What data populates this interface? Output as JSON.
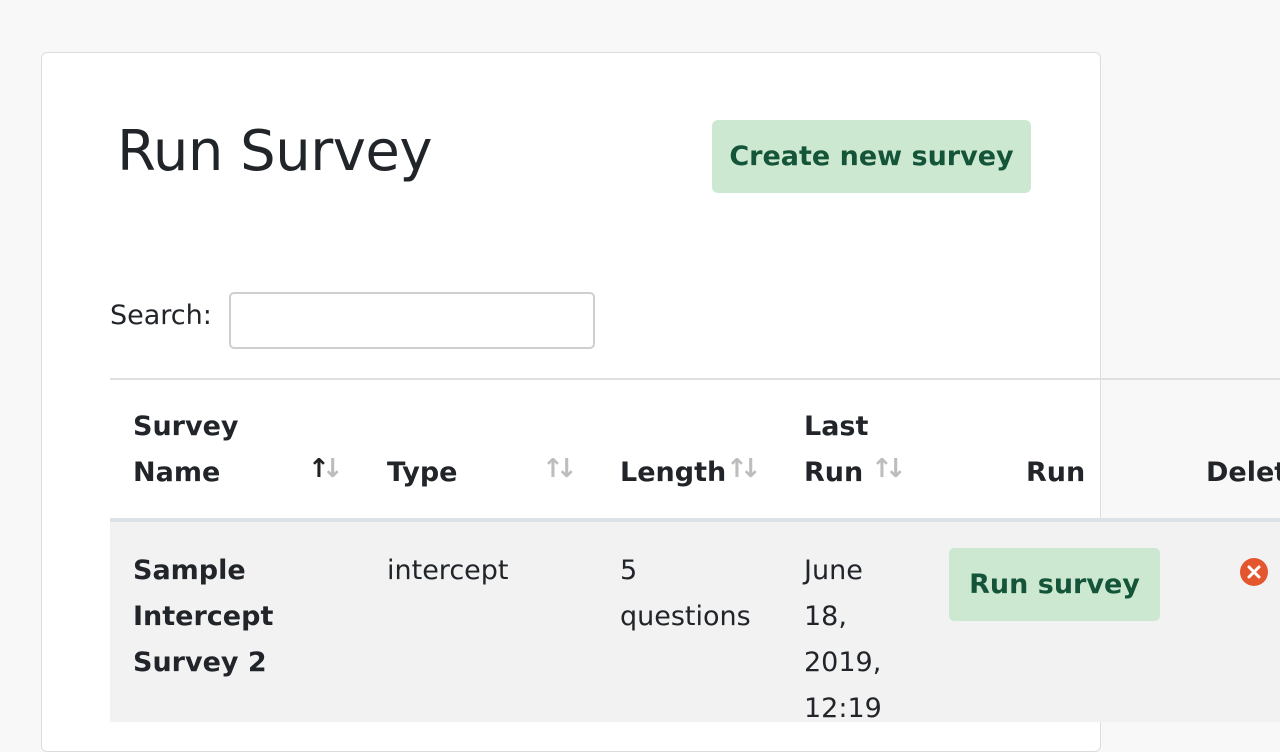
{
  "page": {
    "title": "Run Survey",
    "create_button_label": "Create new survey"
  },
  "search": {
    "label": "Search:",
    "value": "",
    "placeholder": ""
  },
  "table": {
    "headers": {
      "survey_name_1": "Survey",
      "survey_name_2": "Name",
      "type": "Type",
      "length": "Length",
      "last_run_1": "Last",
      "last_run_2": "Run",
      "run": "Run",
      "delete": "Delete"
    },
    "sort": {
      "up": "↑",
      "down": "↓"
    },
    "rows": [
      {
        "name_line1": "Sample",
        "name_line2": "Intercept",
        "name_line3": "Survey 2",
        "type": "intercept",
        "length_line1": "5",
        "length_line2": "questions",
        "last_run_line1": "June",
        "last_run_line2": "18,",
        "last_run_line3": "2019,",
        "last_run_line4": "12:19",
        "run_button_label": "Run survey",
        "delete_icon": "delete-circle-x-icon"
      }
    ]
  },
  "colors": {
    "button_bg": "#cce8d0",
    "button_text": "#14553a",
    "delete_icon": "#e4572e",
    "row_bg": "#f2f2f2"
  }
}
